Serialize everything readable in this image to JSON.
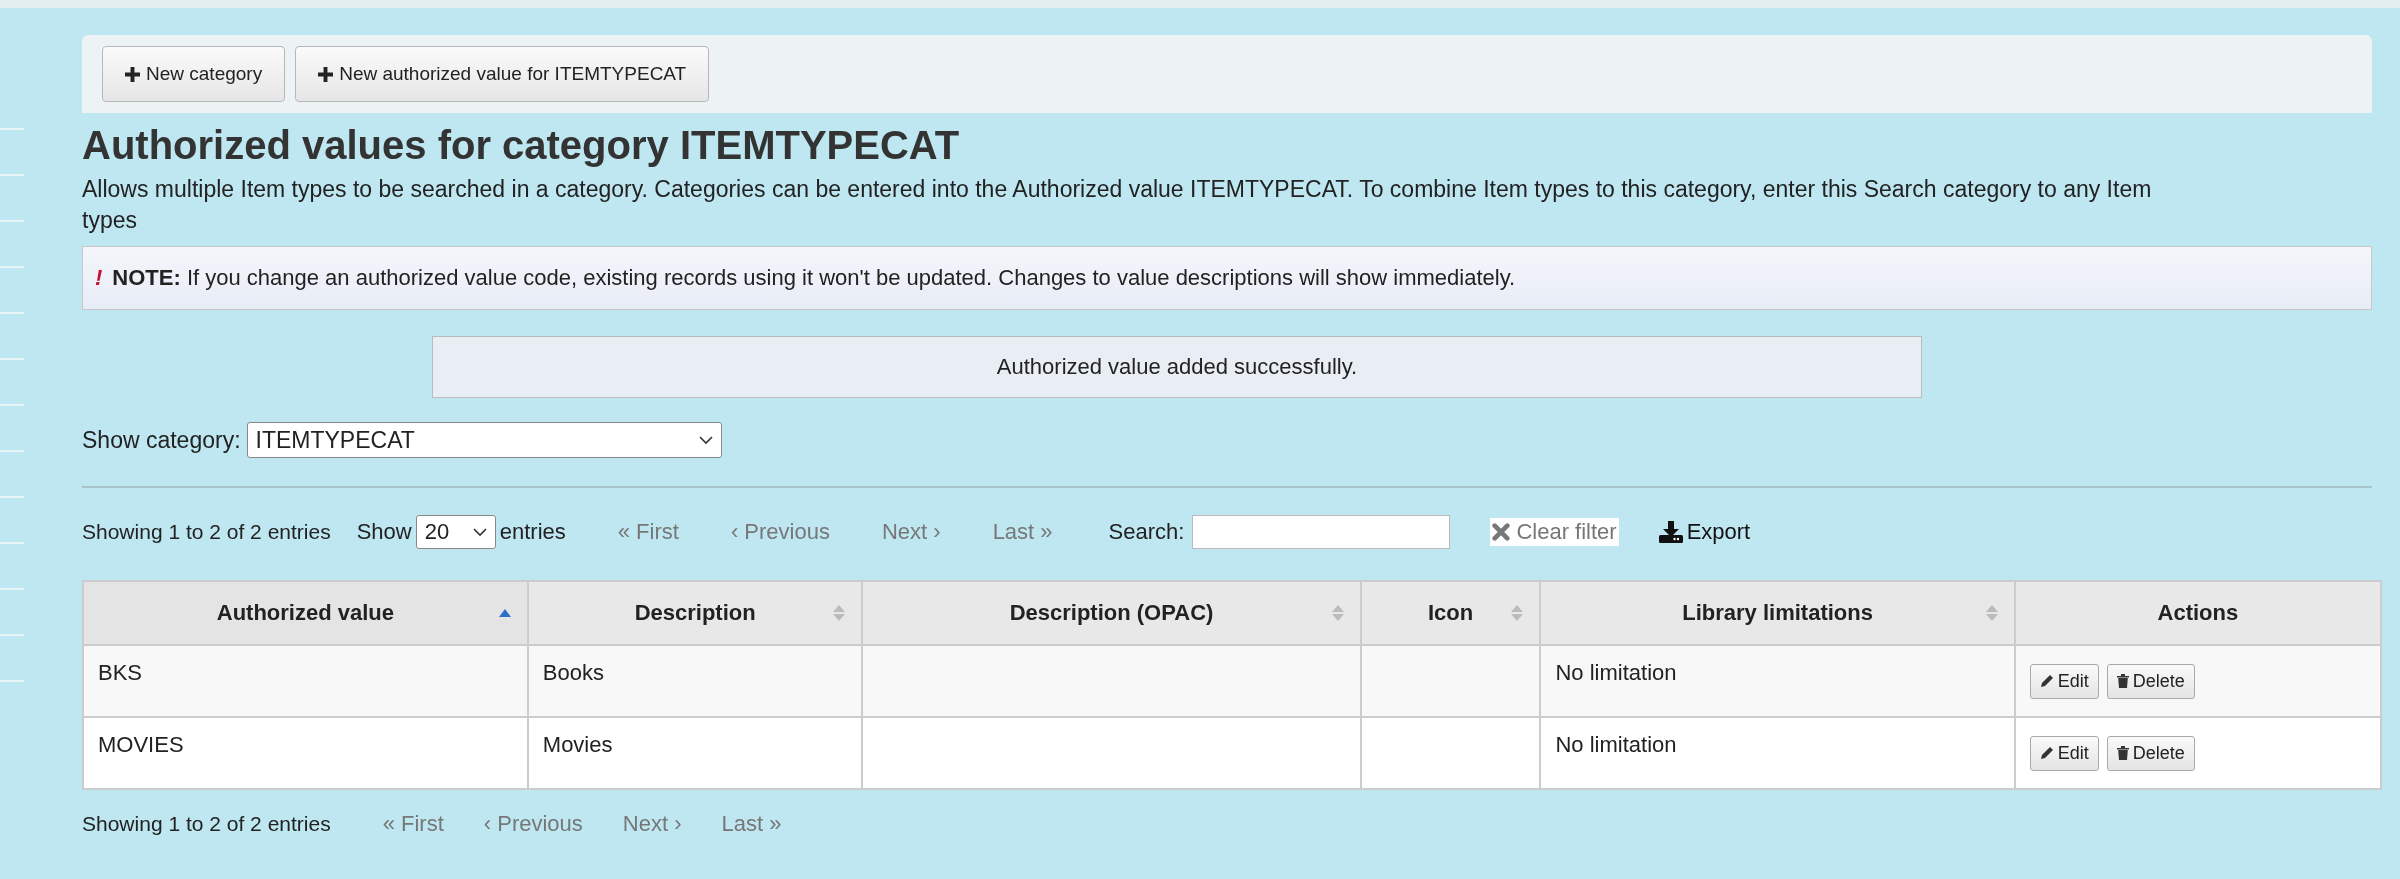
{
  "toolbar": {
    "buttons": [
      {
        "label": "New category"
      },
      {
        "label": "New authorized value for ITEMTYPECAT"
      }
    ]
  },
  "heading": "Authorized values for category ITEMTYPECAT",
  "description": "Allows multiple Item types to be searched in a category. Categories can be entered into the Authorized value ITEMTYPECAT. To combine Item types to this category, enter this Search category to any Item types",
  "note": {
    "marker": "!",
    "text": "**NOTE:** If you change an authorized value code, existing records using it won't be updated. Changes to value descriptions will show immediately."
  },
  "message": "Authorized value added successfully.",
  "category_filter": {
    "label": "Show category:",
    "value": "ITEMTYPECAT"
  },
  "table_controls": {
    "info": "Showing 1 to 2 of 2 entries",
    "show_label": "Show",
    "page_size": "20",
    "entries_label": "entries",
    "pager": [
      {
        "label": "« First",
        "disabled": true
      },
      {
        "label": "‹ Previous",
        "disabled": true
      },
      {
        "label": "Next ›",
        "disabled": true
      },
      {
        "label": "Last »",
        "disabled": true
      }
    ],
    "search_label": "Search:",
    "clear_filter": {
      "label": "Clear filter",
      "disabled": true
    },
    "export": "Export"
  },
  "table": {
    "columns": [
      {
        "label": "Authorized value",
        "sortable": true,
        "sorted": true
      },
      {
        "label": "Description",
        "sortable": true,
        "sorted": false
      },
      {
        "label": "Description (OPAC)",
        "sortable": true,
        "sorted": false
      },
      {
        "label": "Icon",
        "sortable": true,
        "sorted": false
      },
      {
        "label": "Library limitations",
        "sortable": true,
        "sorted": false
      },
      {
        "label": "Actions",
        "sortable": false,
        "sorted": false
      }
    ],
    "rows": [
      {
        "cells": [
          "BKS",
          "Books",
          "",
          "",
          "No limitation"
        ],
        "actions": [
          "Edit",
          "Delete"
        ]
      },
      {
        "cells": [
          "MOVIES",
          "Movies",
          "",
          "",
          "No limitation"
        ],
        "actions": [
          "Edit",
          "Delete"
        ]
      }
    ]
  },
  "bottom_controls": {
    "info": "Showing 1 to 2 of 2 entries",
    "pager": [
      {
        "label": "« First",
        "disabled": true
      },
      {
        "label": "‹ Previous",
        "disabled": true
      },
      {
        "label": "Next ›",
        "disabled": true
      },
      {
        "label": "Last »",
        "disabled": true
      }
    ]
  }
}
